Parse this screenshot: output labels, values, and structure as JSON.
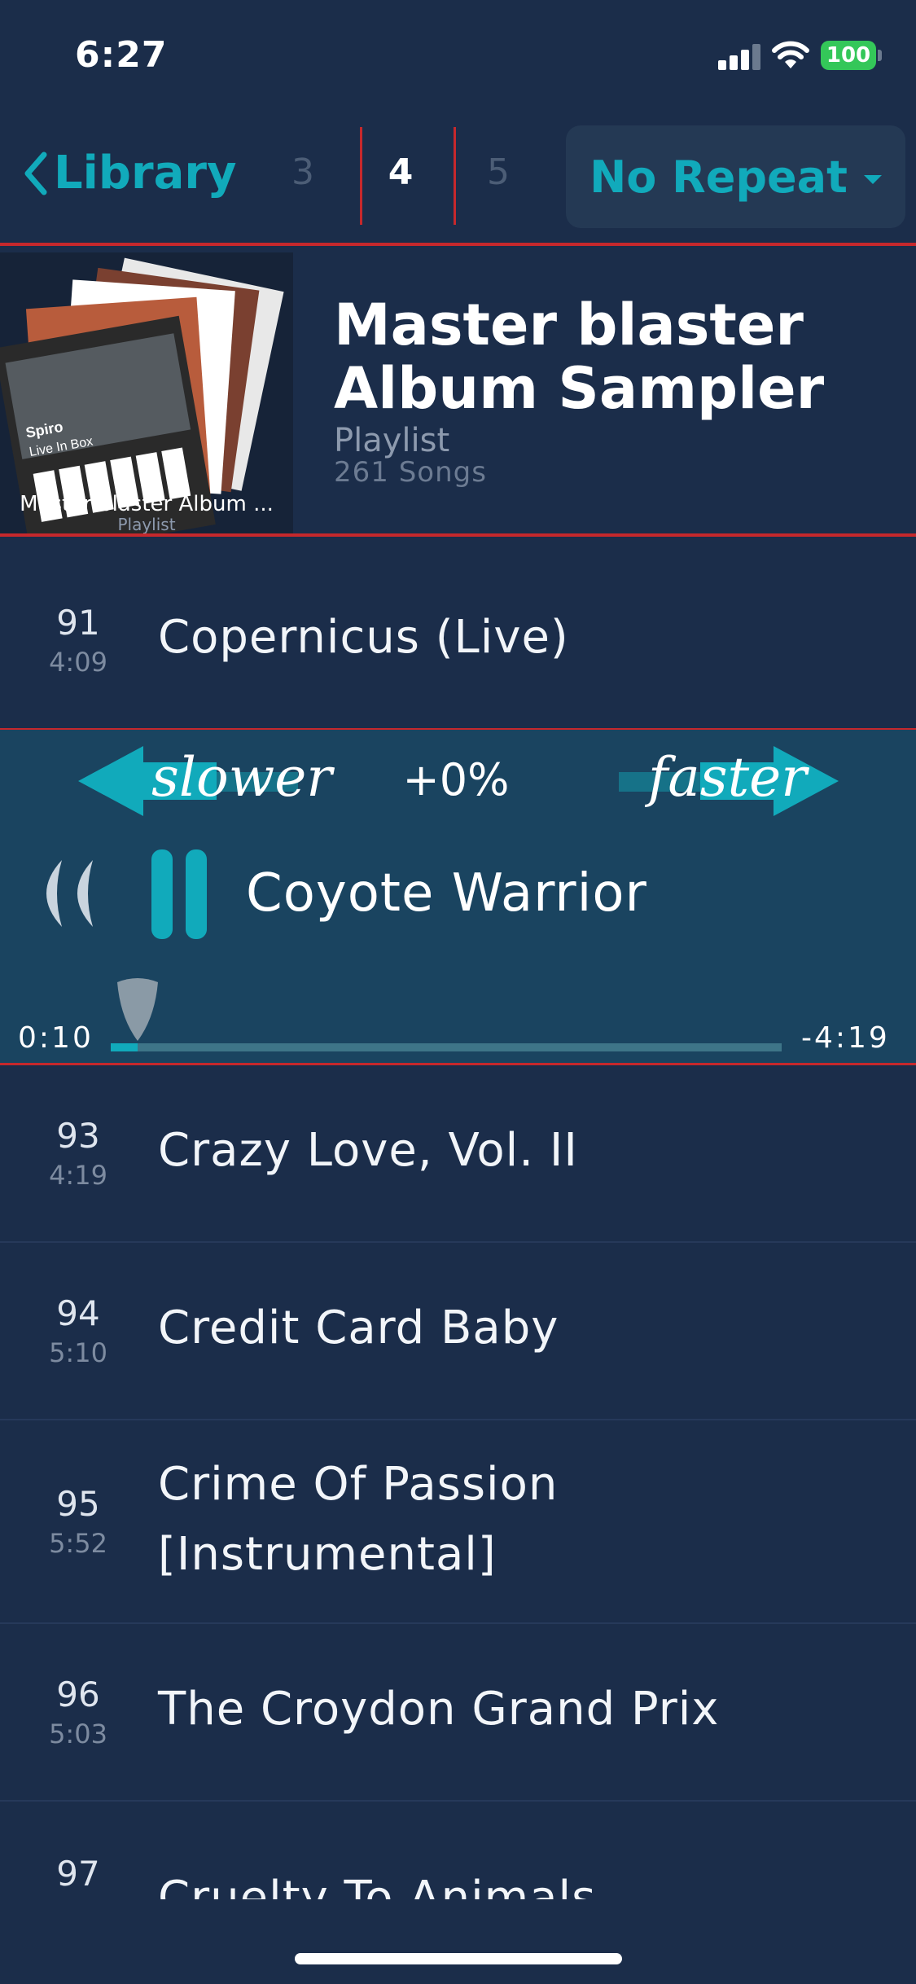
{
  "status": {
    "time": "6:27",
    "battery": "100"
  },
  "header": {
    "back_label": "Library",
    "pages": [
      "3",
      "4",
      "5"
    ],
    "repeat_label": "No Repeat"
  },
  "playlist": {
    "title_line1": "Master blaster",
    "title_line2": "Album Sampler",
    "kind": "Playlist",
    "count": "261 Songs",
    "art_caption": "Master blaster Album ...",
    "art_caption_sub": "Playlist",
    "art_text_1": "Spiro",
    "art_text_2": "Live In Box"
  },
  "player": {
    "slower_label": "slower",
    "faster_label": "faster",
    "speed": "+0%",
    "now_playing": "Coyote Warrior",
    "elapsed": "0:10",
    "remaining": "-4:19",
    "progress": 0.04
  },
  "songs": [
    {
      "num": "91",
      "dur": "4:09",
      "title": "Copernicus (Live)"
    },
    {
      "num": "93",
      "dur": "4:19",
      "title": "Crazy Love, Vol. II"
    },
    {
      "num": "94",
      "dur": "5:10",
      "title": "Credit Card Baby"
    },
    {
      "num": "95",
      "dur": "5:52",
      "title_line1": "Crime Of Passion",
      "title_line2": "[Instrumental]"
    },
    {
      "num": "96",
      "dur": "5:03",
      "title": "The Croydon Grand Prix"
    },
    {
      "num": "97",
      "title": "Cruelty To Animals"
    }
  ],
  "colors": {
    "accent": "#11aabb",
    "background": "#1b2d4a",
    "divider": "#c6282c",
    "player_bg": "#1a4460"
  }
}
